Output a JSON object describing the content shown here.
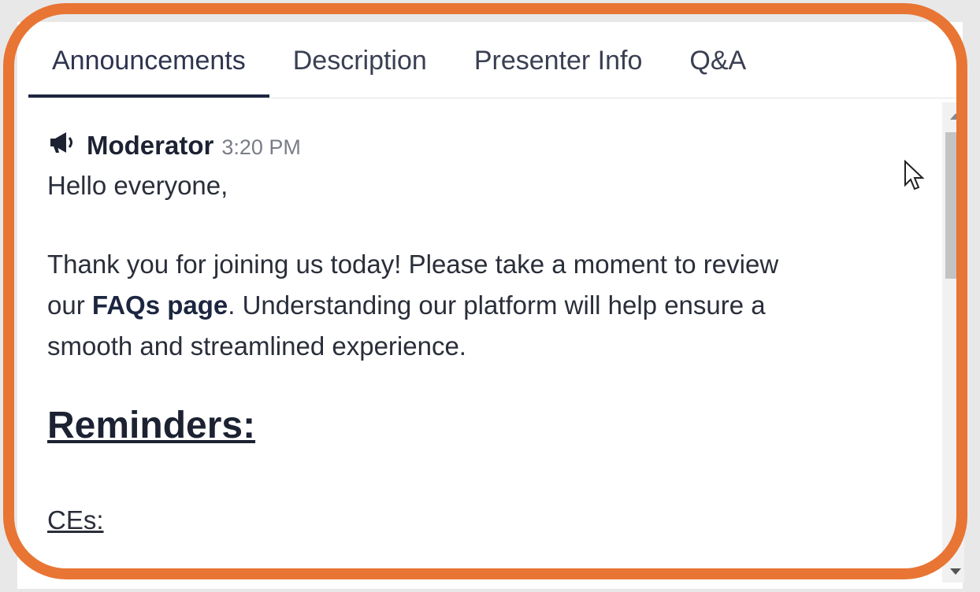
{
  "tabs": [
    {
      "label": "Announcements",
      "active": true
    },
    {
      "label": "Description",
      "active": false
    },
    {
      "label": "Presenter Info",
      "active": false
    },
    {
      "label": "Q&A",
      "active": false
    }
  ],
  "message": {
    "icon": "megaphone-icon",
    "author": "Moderator",
    "time": "3:20 PM",
    "greeting": "Hello everyone,",
    "body_line1": "Thank you for joining us today! Please take a moment to review",
    "body_line2_prefix": "our ",
    "body_link": "FAQs page",
    "body_line2_suffix": ". Understanding our platform will help ensure a",
    "body_line3": "smooth and streamlined experience.",
    "reminders_heading": "Reminders:",
    "ces_label": "CEs:"
  },
  "colors": {
    "highlight_border": "#e87534",
    "active_tab_underline": "#1d2640"
  }
}
